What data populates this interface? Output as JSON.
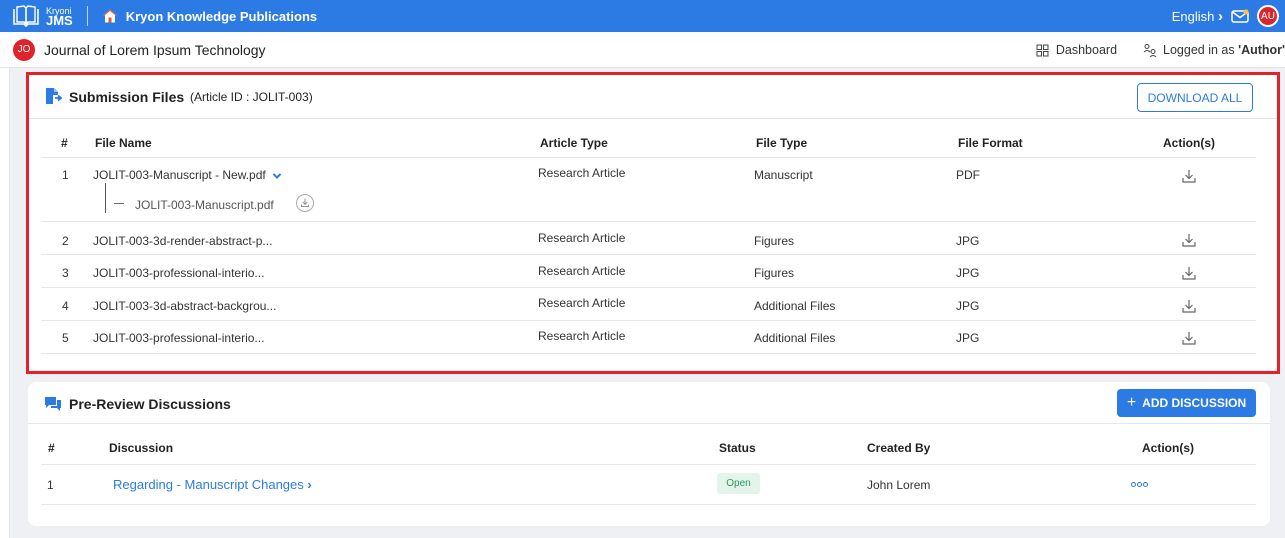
{
  "topbar": {
    "logo_small": "Kryoni",
    "logo_big": "JMS",
    "publisher": "Kryon Knowledge Publications",
    "language": "English",
    "language_caret": "›",
    "user_initials": "AU",
    "colors": {
      "bar": "#2c7be5",
      "avatar": "#d8262c"
    }
  },
  "journalbar": {
    "initials": "JO",
    "title": "Journal of Lorem Ipsum Technology",
    "dashboard": "Dashboard",
    "logged_in_prefix": "Logged in as ",
    "logged_in_role": "'Author'"
  },
  "submission": {
    "title": "Submission Files",
    "article_id": "(Article ID : JOLIT-003)",
    "download_all": "DOWNLOAD ALL",
    "columns": [
      "#",
      "File Name",
      "Article Type",
      "File Type",
      "File Format",
      "Action(s)"
    ],
    "rows": [
      {
        "num": "1",
        "name": "JOLIT-003-Manuscript - New.pdf",
        "article_type": "Research Article",
        "file_type": "Manuscript",
        "format": "PDF",
        "expanded": true,
        "subfile": "JOLIT-003-Manuscript.pdf"
      },
      {
        "num": "2",
        "name": "JOLIT-003-3d-render-abstract-p...",
        "article_type": "Research Article",
        "file_type": "Figures",
        "format": "JPG"
      },
      {
        "num": "3",
        "name": "JOLIT-003-professional-interio...",
        "article_type": "Research Article",
        "file_type": "Figures",
        "format": "JPG"
      },
      {
        "num": "4",
        "name": "JOLIT-003-3d-abstract-backgrou...",
        "article_type": "Research Article",
        "file_type": "Additional Files",
        "format": "JPG"
      },
      {
        "num": "5",
        "name": "JOLIT-003-professional-interio...",
        "article_type": "Research Article",
        "file_type": "Additional Files",
        "format": "JPG"
      }
    ],
    "icons": [
      "file-upload-icon",
      "chevron-down-icon",
      "download-icon",
      "download-circle-icon"
    ]
  },
  "discussions": {
    "title": "Pre-Review Discussions",
    "add_button": "ADD DISCUSSION",
    "columns": [
      "#",
      "Discussion",
      "Status",
      "Created By",
      "Action(s)"
    ],
    "rows": [
      {
        "num": "1",
        "discussion": "Regarding - Manuscript Changes",
        "status": "Open",
        "created_by": "John Lorem"
      }
    ],
    "icons": [
      "chat-icon",
      "plus-icon",
      "chevron-right-icon",
      "more-options-icon"
    ],
    "colors": {
      "status_bg": "#e3f5ea",
      "status_text": "#2a9a55",
      "highlight_frame": "#e4202a"
    }
  }
}
